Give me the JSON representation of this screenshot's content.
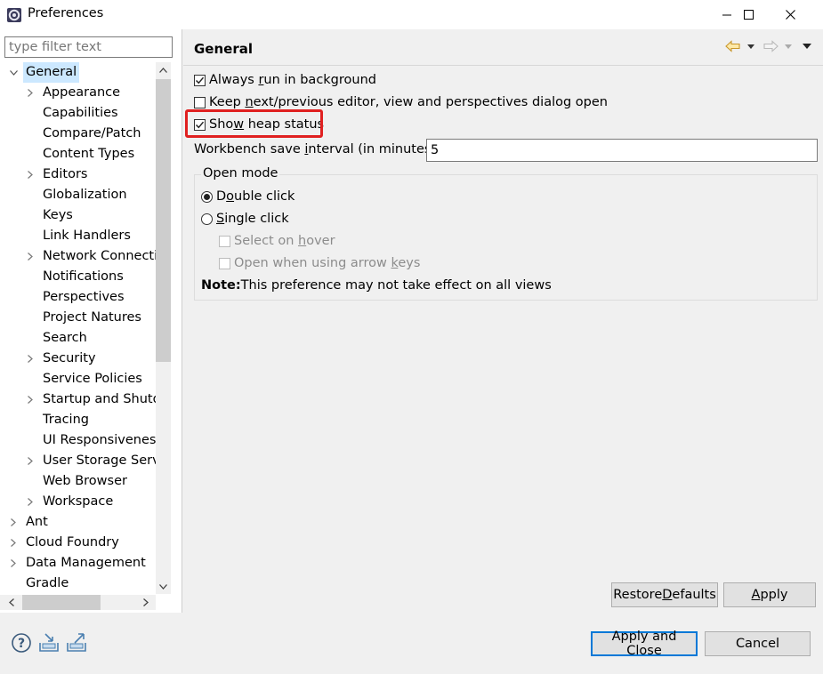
{
  "window": {
    "title": "Preferences",
    "minimize_icon": "minimize-icon",
    "maximize_icon": "maximize-icon",
    "close_icon": "close-icon"
  },
  "filter": {
    "placeholder": "type filter text",
    "value": ""
  },
  "tree": {
    "items": [
      {
        "label": "General",
        "level": 0,
        "expander": "expanded",
        "selected": true
      },
      {
        "label": "Appearance",
        "level": 1,
        "expander": "collapsed"
      },
      {
        "label": "Capabilities",
        "level": 1,
        "expander": "none"
      },
      {
        "label": "Compare/Patch",
        "level": 1,
        "expander": "none"
      },
      {
        "label": "Content Types",
        "level": 1,
        "expander": "none"
      },
      {
        "label": "Editors",
        "level": 1,
        "expander": "collapsed"
      },
      {
        "label": "Globalization",
        "level": 1,
        "expander": "none"
      },
      {
        "label": "Keys",
        "level": 1,
        "expander": "none"
      },
      {
        "label": "Link Handlers",
        "level": 1,
        "expander": "none"
      },
      {
        "label": "Network Connectio",
        "level": 1,
        "expander": "collapsed"
      },
      {
        "label": "Notifications",
        "level": 1,
        "expander": "none"
      },
      {
        "label": "Perspectives",
        "level": 1,
        "expander": "none"
      },
      {
        "label": "Project Natures",
        "level": 1,
        "expander": "none"
      },
      {
        "label": "Search",
        "level": 1,
        "expander": "none"
      },
      {
        "label": "Security",
        "level": 1,
        "expander": "collapsed"
      },
      {
        "label": "Service Policies",
        "level": 1,
        "expander": "none"
      },
      {
        "label": "Startup and Shutdo",
        "level": 1,
        "expander": "collapsed"
      },
      {
        "label": "Tracing",
        "level": 1,
        "expander": "none"
      },
      {
        "label": "UI Responsiveness",
        "level": 1,
        "expander": "none"
      },
      {
        "label": "User Storage Servic",
        "level": 1,
        "expander": "collapsed"
      },
      {
        "label": "Web Browser",
        "level": 1,
        "expander": "none"
      },
      {
        "label": "Workspace",
        "level": 1,
        "expander": "collapsed"
      },
      {
        "label": "Ant",
        "level": 0,
        "expander": "collapsed"
      },
      {
        "label": "Cloud Foundry",
        "level": 0,
        "expander": "collapsed"
      },
      {
        "label": "Data Management",
        "level": 0,
        "expander": "collapsed"
      },
      {
        "label": "Gradle",
        "level": 0,
        "expander": "none"
      }
    ]
  },
  "page": {
    "title": "General",
    "nav": {
      "back_icon": "back-arrow-icon",
      "back_menu_icon": "chevron-down-icon",
      "forward_icon": "forward-arrow-icon",
      "forward_menu_icon": "chevron-down-icon",
      "view_menu_icon": "view-menu-icon"
    },
    "always_run": {
      "pre": "Always ",
      "mnemonic": "r",
      "post": "un in background",
      "checked": true
    },
    "keep_next_prev": {
      "pre": "Keep ",
      "mnemonic": "n",
      "post": "ext/previous editor, view and perspectives dialog open",
      "checked": false
    },
    "show_heap": {
      "pre": "Sho",
      "mnemonic": "w",
      "post": " heap status",
      "checked": true
    },
    "save_interval": {
      "pre": "Workbench save ",
      "mnemonic": "i",
      "post": "nterval (in minutes):",
      "value": "5"
    },
    "open_mode": {
      "title": "Open mode",
      "double_click": {
        "pre": "D",
        "mnemonic": "o",
        "post": "uble click",
        "selected": true
      },
      "single_click": {
        "pre": "",
        "mnemonic": "S",
        "post": "ingle click",
        "selected": false
      },
      "select_on_hover": {
        "pre": "Select on ",
        "mnemonic": "h",
        "post": "over",
        "checked": false,
        "disabled": true
      },
      "open_arrow_keys": {
        "pre": "Open when using arrow ",
        "mnemonic": "k",
        "post": "eys",
        "checked": false,
        "disabled": true
      },
      "note_bold": "Note:",
      "note_text": " This preference may not take effect on all views"
    },
    "restore_defaults": {
      "pre": "Restore ",
      "mnemonic": "D",
      "post": "efaults"
    },
    "apply": {
      "pre": "",
      "mnemonic": "A",
      "post": "pply"
    }
  },
  "footer": {
    "help_icon": "help-icon",
    "import_icon": "import-icon",
    "export_icon": "export-icon",
    "apply_close": "Apply and Close",
    "cancel": "Cancel"
  },
  "colors": {
    "selection": "#cce8ff",
    "highlight_box": "#e02020",
    "default_button_border": "#0078d7"
  }
}
